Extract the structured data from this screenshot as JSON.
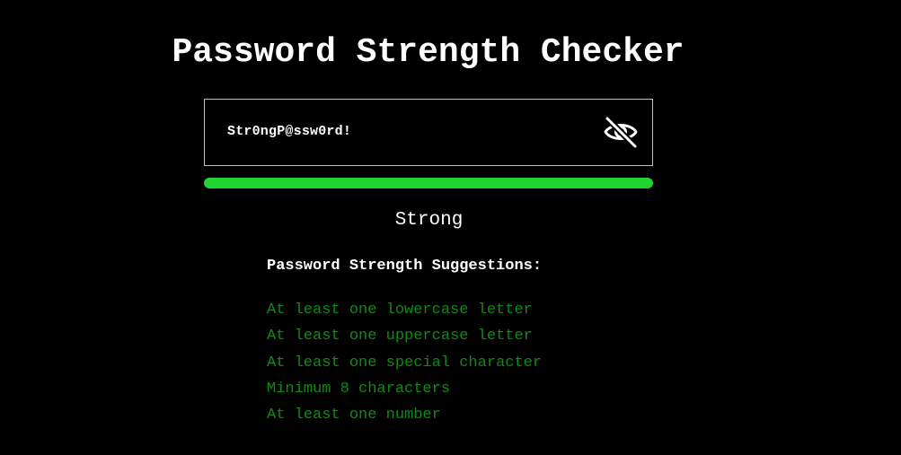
{
  "page": {
    "title": "Password Strength Checker"
  },
  "password": {
    "value": "Str0ngP@ssw0rd!",
    "toggle_icon": "eye-slash-icon"
  },
  "strength": {
    "level_fraction": 1.0,
    "label": "Strong",
    "bar_color": "#22d42e"
  },
  "suggestions": {
    "title": "Password Strength Suggestions:",
    "met_color": "#0f8a14",
    "items": [
      {
        "text": "At least one lowercase letter",
        "met": true
      },
      {
        "text": "At least one uppercase letter",
        "met": true
      },
      {
        "text": "At least one special character",
        "met": true
      },
      {
        "text": "Minimum 8 characters",
        "met": true
      },
      {
        "text": "At least one number",
        "met": true
      }
    ]
  }
}
